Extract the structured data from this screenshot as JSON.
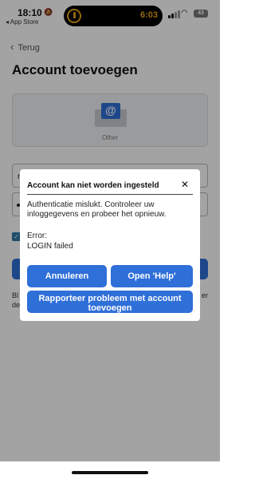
{
  "status_bar": {
    "time": "18:10",
    "back_app": "◂ App Store",
    "timer": "6:03",
    "battery": "43"
  },
  "nav": {
    "back_label": "Terug"
  },
  "page": {
    "title": "Account toevoegen",
    "provider_label": "Other",
    "field1_fragment": "n",
    "hint_left": "Bl",
    "hint_right": "er",
    "hint_left_2": "de"
  },
  "dialog": {
    "title": "Account kan niet worden ingesteld",
    "message": "Authenticatie mislukt. Controleer uw inloggegevens en probeer het opnieuw.",
    "error_label": "Error:",
    "error_value": "LOGIN failed",
    "cancel_label": "Annuleren",
    "help_label": "Open 'Help'",
    "report_label": "Rapporteer probleem met account toevoegen"
  },
  "colors": {
    "accent": "#2f6fd8",
    "timer": "#e8a317"
  }
}
